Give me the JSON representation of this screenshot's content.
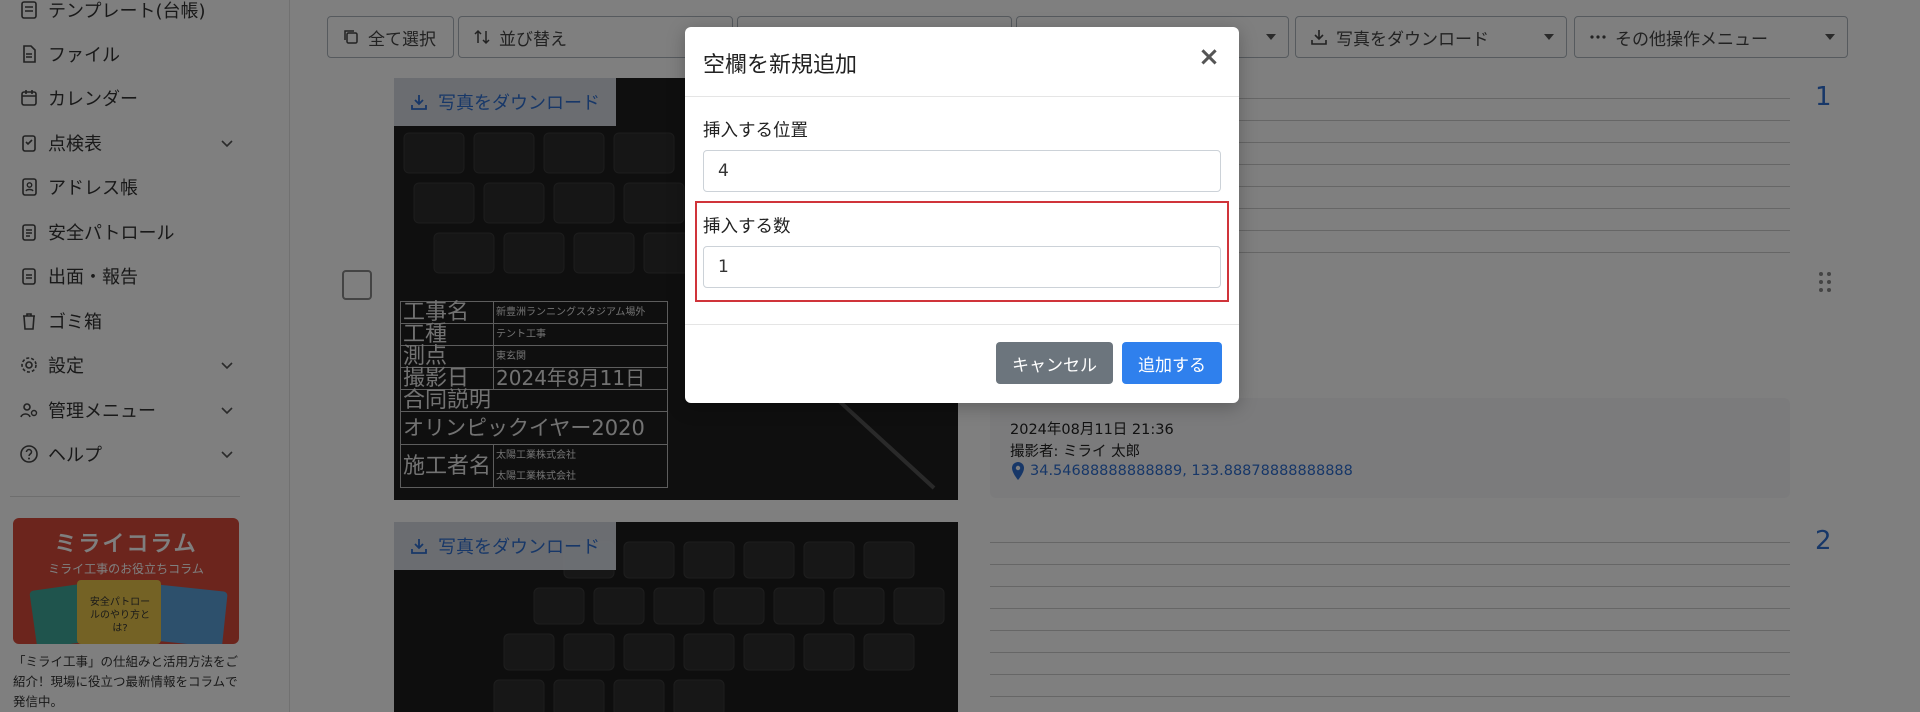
{
  "sidebar": {
    "items": [
      {
        "label": "テンプレート(台帳)",
        "icon": "template-icon"
      },
      {
        "label": "ファイル",
        "icon": "file-icon"
      },
      {
        "label": "カレンダー",
        "icon": "calendar-icon"
      },
      {
        "label": "点検表",
        "icon": "checklist-icon"
      },
      {
        "label": "アドレス帳",
        "icon": "address-book-icon"
      },
      {
        "label": "安全パトロール",
        "icon": "patrol-icon"
      },
      {
        "label": "出面・報告",
        "icon": "report-icon"
      },
      {
        "label": "ゴミ箱",
        "icon": "trash-icon"
      },
      {
        "label": "設定",
        "icon": "gear-icon"
      },
      {
        "label": "管理メニュー",
        "icon": "admin-icon"
      },
      {
        "label": "ヘルプ",
        "icon": "help-icon"
      }
    ],
    "banner": {
      "title": "ミライコラム",
      "subtitle": "ミライ工事のお役立ちコラム",
      "card_text": "安全パトロールのやり方とは?",
      "description": "「ミライ工事」の仕組みと活用方法をご紹介！現場に役立つ最新情報をコラムで発信中。"
    }
  },
  "toolbar": {
    "select_all": "全て選択",
    "sort": "並び替え",
    "download_photos": "写真をダウンロード",
    "other_menu": "その他操作メニュー"
  },
  "photos": [
    {
      "download_label": "写真をダウンロード",
      "index": "1",
      "board": {
        "project_key": "工事名",
        "project_val": "新豊洲ランニングスタジアム場外",
        "type_key": "工種",
        "type_val": "テント工事",
        "point_key": "測点",
        "point_val": "東玄関",
        "date_key": "撮影日",
        "date_val": "2024年8月11日",
        "note_key": "合同説明",
        "note_val": "オリンピックイヤー2020",
        "contractor_key": "施工者名",
        "contractor_val1": "太陽工業株式会社",
        "contractor_val2": "太陽工業株式会社"
      },
      "info": {
        "datetime": "2024年08月11日 21:36",
        "photographer": "撮影者: ミライ 太郎",
        "coords": "34.54688888888889, 133.88878888888888"
      }
    },
    {
      "download_label": "写真をダウンロード",
      "index": "2"
    }
  ],
  "modal": {
    "title": "空欄を新規追加",
    "close_symbol": "×",
    "position_label": "挿入する位置",
    "position_value": "4",
    "count_label": "挿入する数",
    "count_value": "1",
    "cancel_label": "キャンセル",
    "add_label": "追加する"
  },
  "colors": {
    "accent": "#2f80ed",
    "link": "#2f6fd1",
    "cancel": "#6c757d",
    "highlight": "#d0343a"
  }
}
